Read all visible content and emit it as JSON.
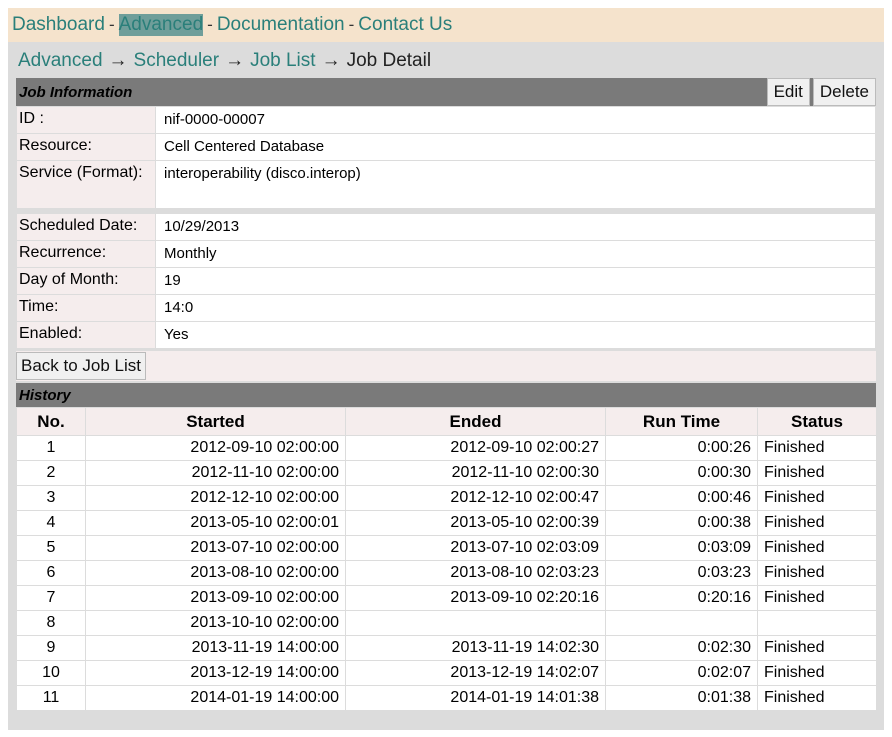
{
  "topnav": {
    "items": [
      {
        "label": "Dashboard",
        "active": false
      },
      {
        "label": "Advanced",
        "active": true
      },
      {
        "label": "Documentation",
        "active": false
      },
      {
        "label": "Contact Us",
        "active": false
      }
    ],
    "separator": "-"
  },
  "breadcrumb": {
    "items": [
      "Advanced",
      "Scheduler",
      "Job List"
    ],
    "current": "Job Detail",
    "arrow": "→"
  },
  "job_info": {
    "title": "Job Information",
    "edit_label": "Edit",
    "delete_label": "Delete",
    "rows1": [
      {
        "label": "ID :",
        "value": "nif-0000-00007"
      },
      {
        "label": "Resource:",
        "value": "Cell Centered Database"
      },
      {
        "label": "Service (Format):",
        "value": "interoperability (disco.interop)"
      }
    ],
    "rows2": [
      {
        "label": "Scheduled Date:",
        "value": "10/29/2013"
      },
      {
        "label": "Recurrence:",
        "value": "Monthly"
      },
      {
        "label": "Day of Month:",
        "value": "19"
      },
      {
        "label": "Time:",
        "value": "14:0"
      },
      {
        "label": "Enabled:",
        "value": "Yes"
      }
    ],
    "back_label": "Back to Job List"
  },
  "history": {
    "title": "History",
    "columns": [
      "No.",
      "Started",
      "Ended",
      "Run Time",
      "Status"
    ],
    "rows": [
      [
        "1",
        "2012-09-10 02:00:00",
        "2012-09-10 02:00:27",
        "0:00:26",
        "Finished"
      ],
      [
        "2",
        "2012-11-10 02:00:00",
        "2012-11-10 02:00:30",
        "0:00:30",
        "Finished"
      ],
      [
        "3",
        "2012-12-10 02:00:00",
        "2012-12-10 02:00:47",
        "0:00:46",
        "Finished"
      ],
      [
        "4",
        "2013-05-10 02:00:01",
        "2013-05-10 02:00:39",
        "0:00:38",
        "Finished"
      ],
      [
        "5",
        "2013-07-10 02:00:00",
        "2013-07-10 02:03:09",
        "0:03:09",
        "Finished"
      ],
      [
        "6",
        "2013-08-10 02:00:00",
        "2013-08-10 02:03:23",
        "0:03:23",
        "Finished"
      ],
      [
        "7",
        "2013-09-10 02:00:00",
        "2013-09-10 02:20:16",
        "0:20:16",
        "Finished"
      ],
      [
        "8",
        "2013-10-10 02:00:00",
        "",
        "",
        ""
      ],
      [
        "9",
        "2013-11-19 14:00:00",
        "2013-11-19 14:02:30",
        "0:02:30",
        "Finished"
      ],
      [
        "10",
        "2013-12-19 14:00:00",
        "2013-12-19 14:02:07",
        "0:02:07",
        "Finished"
      ],
      [
        "11",
        "2014-01-19 14:00:00",
        "2014-01-19 14:01:38",
        "0:01:38",
        "Finished"
      ]
    ]
  }
}
